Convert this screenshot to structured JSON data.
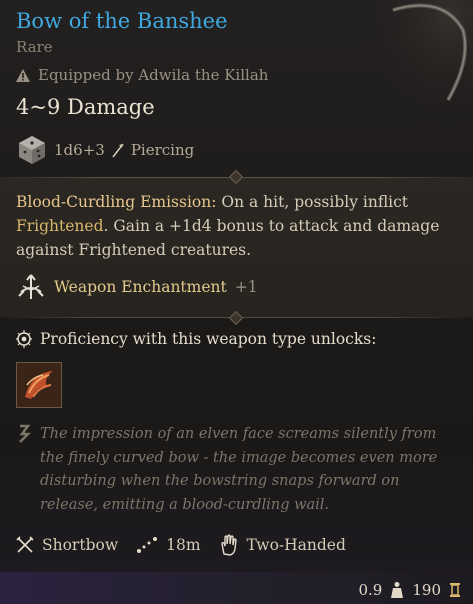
{
  "item": {
    "name": "Bow of the Banshee",
    "rarity": "Rare",
    "equipped": "Equipped by Adwila the Killah",
    "damage": "4~9 Damage",
    "damage_dice": "1d6+3",
    "damage_type": "Piercing"
  },
  "passive": {
    "name": "Blood-Curdling Emission:",
    "text_1": " On a hit, possibly inflict ",
    "condition": "Frightened",
    "text_2": ". Gain a +1d4 bonus to attack and damage against Frightened creatures."
  },
  "enchantment": {
    "label": "Weapon Enchantment",
    "bonus": "+1"
  },
  "proficiency": {
    "label": "Proficiency with this weapon type unlocks:"
  },
  "flavor": "The impression of an elven face screams silently from the finely curved bow - the image becomes even more disturbing when the bowstring snaps forward on release, emitting a blood-curdling wail.",
  "properties": {
    "weapon_type": "Shortbow",
    "range": "18m",
    "handedness": "Two-Handed"
  },
  "stats": {
    "weight": "0.9",
    "value": "190"
  },
  "colors": {
    "rarity_title": "#3fa9e0",
    "highlight": "#e8c58a",
    "enchant": "#e2c98c"
  },
  "icons": [
    "warning-icon",
    "die-icon",
    "arrow-icon",
    "enchantment-icon",
    "proficiency-icon",
    "unlock-ability-icon",
    "quill-icon",
    "shortbow-icon",
    "range-icon",
    "hand-icon",
    "weight-icon",
    "gold-icon"
  ]
}
